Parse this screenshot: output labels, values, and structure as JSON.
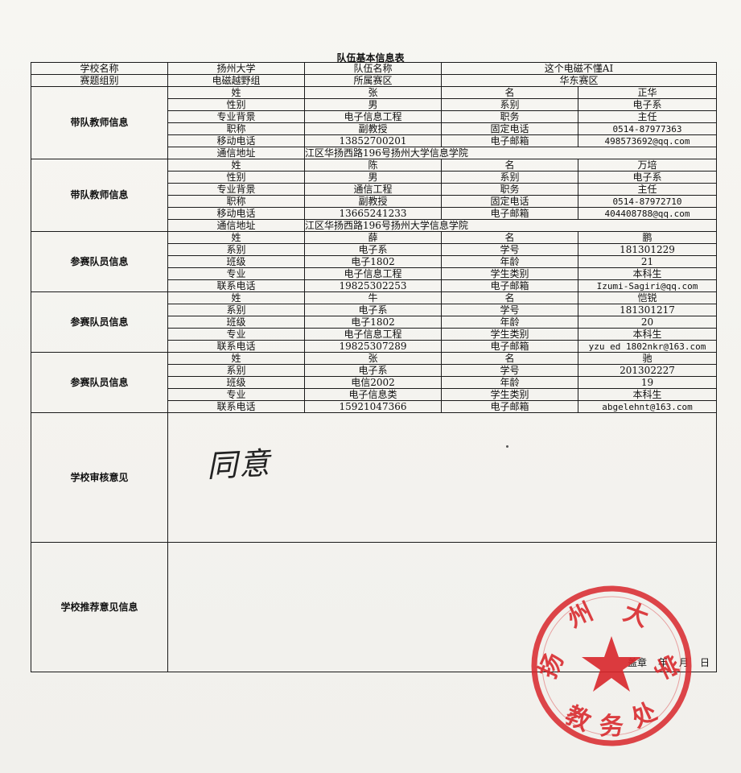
{
  "title": "队伍基本信息表",
  "header": {
    "school_label": "学校名称",
    "school_value": "扬州大学",
    "team_label": "队伍名称",
    "team_value": "这个电磁不懂AI",
    "group_label": "赛题组别",
    "group_value": "电磁越野组",
    "region_label": "所属赛区",
    "region_value": "华东赛区"
  },
  "teachers": [
    {
      "section": "带队教师信息",
      "surname_label": "姓",
      "surname": "张",
      "name_label": "名",
      "name": "正华",
      "gender_label": "性别",
      "gender": "男",
      "dept_label": "系别",
      "dept": "电子系",
      "major_label": "专业背景",
      "major": "电子信息工程",
      "post_label": "职务",
      "post": "主任",
      "title_label": "职称",
      "title": "副教授",
      "phone_label": "固定电话",
      "phone": "0514-87977363",
      "mobile_label": "移动电话",
      "mobile": "13852700201",
      "email_label": "电子邮箱",
      "email": "498573692@qq.com",
      "addr_label": "通信地址",
      "addr": "江区华扬西路196号扬州大学信息学院"
    },
    {
      "section": "带队教师信息",
      "surname_label": "姓",
      "surname": "陈",
      "name_label": "名",
      "name": "万培",
      "gender_label": "性别",
      "gender": "男",
      "dept_label": "系别",
      "dept": "电子系",
      "major_label": "专业背景",
      "major": "通信工程",
      "post_label": "职务",
      "post": "主任",
      "title_label": "职称",
      "title": "副教授",
      "phone_label": "固定电话",
      "phone": "0514-87972710",
      "mobile_label": "移动电话",
      "mobile": "13665241233",
      "email_label": "电子邮箱",
      "email": "404408788@qq.com",
      "addr_label": "通信地址",
      "addr": "江区华扬西路196号扬州大学信息学院"
    }
  ],
  "members": [
    {
      "section": "参赛队员信息",
      "surname_label": "姓",
      "surname": "薛",
      "name_label": "名",
      "name": "鹏",
      "dept_label": "系别",
      "dept": "电子系",
      "id_label": "学号",
      "id": "181301229",
      "class_label": "班级",
      "class": "电子1802",
      "age_label": "年龄",
      "age": "21",
      "major_label": "专业",
      "major": "电子信息工程",
      "type_label": "学生类别",
      "type": "本科生",
      "phone_label": "联系电话",
      "phone": "19825302253",
      "email_label": "电子邮箱",
      "email": "Izumi-Sagiri@qq.com"
    },
    {
      "section": "参赛队员信息",
      "surname_label": "姓",
      "surname": "牛",
      "name_label": "名",
      "name": "恺锐",
      "dept_label": "系别",
      "dept": "电子系",
      "id_label": "学号",
      "id": "181301217",
      "class_label": "班级",
      "class": "电子1802",
      "age_label": "年龄",
      "age": "20",
      "major_label": "专业",
      "major": "电子信息工程",
      "type_label": "学生类别",
      "type": "本科生",
      "phone_label": "联系电话",
      "phone": "19825307289",
      "email_label": "电子邮箱",
      "email": "yzu ed 1802nkr@163.com"
    },
    {
      "section": "参赛队员信息",
      "surname_label": "姓",
      "surname": "张",
      "name_label": "名",
      "name": "驰",
      "dept_label": "系别",
      "dept": "电子系",
      "id_label": "学号",
      "id": "201302227",
      "class_label": "班级",
      "class": "电信2002",
      "age_label": "年龄",
      "age": "19",
      "major_label": "专业",
      "major": "电子信息类",
      "type_label": "学生类别",
      "type": "本科生",
      "phone_label": "联系电话",
      "phone": "15921047366",
      "email_label": "电子邮箱",
      "email": "abgelehnt@163.com"
    }
  ],
  "opinion": {
    "label": "学校审核意见",
    "signature": "同意"
  },
  "recommend": {
    "label": "学校推荐意见信息",
    "stamp_label": "盖章",
    "year_label": "年",
    "month_label": "月",
    "day_label": "日"
  },
  "seal": {
    "text": "扬州大学教务处",
    "color": "#d8262a"
  }
}
